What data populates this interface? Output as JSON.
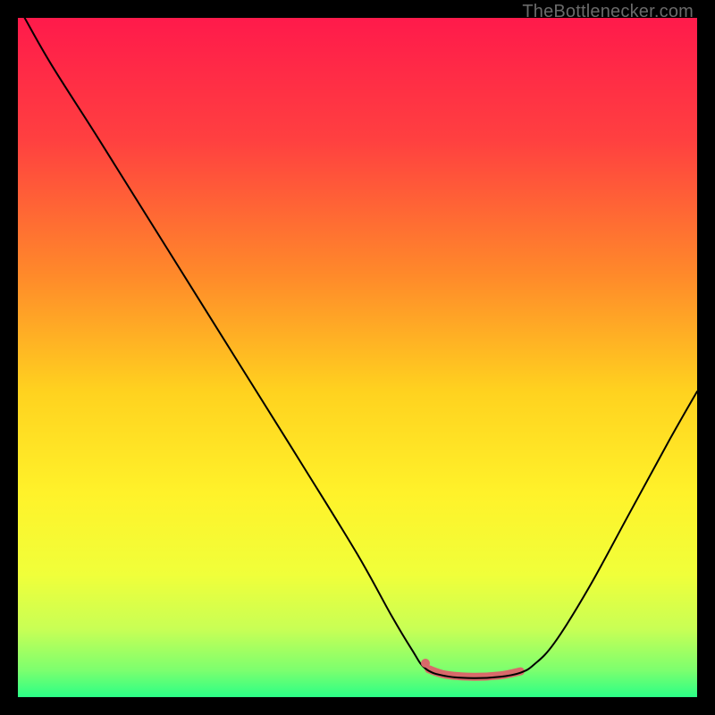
{
  "watermark": "TheBottleneсker.com",
  "chart_data": {
    "type": "line",
    "title": "",
    "xlabel": "",
    "ylabel": "",
    "xlim": [
      0,
      100
    ],
    "ylim": [
      0,
      100
    ],
    "grid": false,
    "background_gradient": {
      "stops": [
        {
          "offset": 0,
          "color": "#ff1a4b"
        },
        {
          "offset": 18,
          "color": "#ff4040"
        },
        {
          "offset": 38,
          "color": "#ff8a2a"
        },
        {
          "offset": 55,
          "color": "#ffd21f"
        },
        {
          "offset": 70,
          "color": "#fff22a"
        },
        {
          "offset": 82,
          "color": "#f0ff3a"
        },
        {
          "offset": 90,
          "color": "#c8ff55"
        },
        {
          "offset": 96,
          "color": "#7dff6e"
        },
        {
          "offset": 100,
          "color": "#2bff86"
        }
      ]
    },
    "series": [
      {
        "name": "bottleneck-curve",
        "color": "#000000",
        "width": 2,
        "points": [
          {
            "x": 1,
            "y": 100
          },
          {
            "x": 5,
            "y": 93
          },
          {
            "x": 12,
            "y": 82
          },
          {
            "x": 22,
            "y": 66
          },
          {
            "x": 32,
            "y": 50
          },
          {
            "x": 42,
            "y": 34
          },
          {
            "x": 50,
            "y": 21
          },
          {
            "x": 55,
            "y": 12
          },
          {
            "x": 58,
            "y": 7
          },
          {
            "x": 60,
            "y": 4.2
          },
          {
            "x": 63,
            "y": 3.1
          },
          {
            "x": 67,
            "y": 2.8
          },
          {
            "x": 71,
            "y": 3.0
          },
          {
            "x": 74,
            "y": 3.6
          },
          {
            "x": 76,
            "y": 4.8
          },
          {
            "x": 79,
            "y": 8
          },
          {
            "x": 84,
            "y": 16
          },
          {
            "x": 90,
            "y": 27
          },
          {
            "x": 96,
            "y": 38
          },
          {
            "x": 100,
            "y": 45
          }
        ]
      }
    ],
    "highlights": [
      {
        "name": "optimal-range",
        "color": "#d86a6a",
        "width": 9,
        "points": [
          {
            "x": 60.5,
            "y": 4.1
          },
          {
            "x": 63,
            "y": 3.3
          },
          {
            "x": 67,
            "y": 3.0
          },
          {
            "x": 71,
            "y": 3.2
          },
          {
            "x": 74,
            "y": 3.8
          }
        ]
      }
    ],
    "markers": [
      {
        "name": "optimal-start-dot",
        "x": 60,
        "y": 5.0,
        "r": 5,
        "color": "#d86a6a"
      }
    ]
  }
}
